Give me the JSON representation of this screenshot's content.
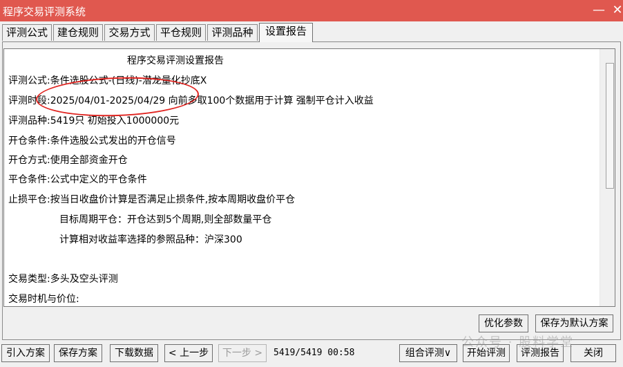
{
  "window": {
    "title": "程序交易评测系统"
  },
  "tabs": [
    "评测公式",
    "建仓规则",
    "交易方式",
    "平仓规则",
    "评测品种",
    "设置报告"
  ],
  "report": {
    "title": "程序交易评测设置报告",
    "lines": [
      {
        "label": "评测公式:",
        "value": "条件选股公式-(日线)-潜龙量化抄底X"
      },
      {
        "label": "评测时段:",
        "value": "2025/04/01-2025/04/29 向前多取100个数据用于计算 强制平仓计入收益"
      },
      {
        "label": "评测品种:",
        "value": "5419只 初始投入1000000元"
      },
      {
        "label": "开仓条件:",
        "value": "条件选股公式发出的开仓信号"
      },
      {
        "label": "开仓方式:",
        "value": "使用全部资金开仓"
      },
      {
        "label": "平仓条件:",
        "value": "公式中定义的平仓条件"
      },
      {
        "label": "止损平仓:",
        "value": "按当日收盘价计算是否满足止损条件,按本周期收盘价平仓"
      },
      {
        "label": "",
        "value": "目标周期平仓：开仓达到5个周期,则全部数量平仓"
      },
      {
        "label": "",
        "value": "计算相对收益率选择的参照品种：沪深300"
      },
      {
        "label": "交易类型:",
        "value": "多头及空头评测"
      },
      {
        "label": "交易时机与价位:",
        "value": ""
      }
    ]
  },
  "actions": {
    "optimize": "优化参数",
    "save_default": "保存为默认方案"
  },
  "bottom": {
    "import": "引入方案",
    "save": "保存方案",
    "download": "下载数据",
    "prev": "< 上一步",
    "next": "下一步 >",
    "status": "5419/5419 00:58",
    "combo": "组合评测",
    "combo_arrow": "∨",
    "start": "开始评测",
    "report": "评测报告",
    "close": "关闭"
  },
  "watermark": "公众号 · 股料学堂",
  "colors": {
    "titlebar": "#e0584f",
    "annotation": "#e02420"
  }
}
